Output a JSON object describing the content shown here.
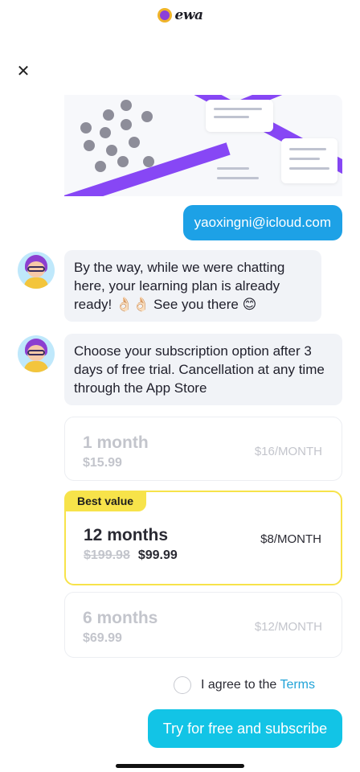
{
  "app": {
    "logo_text": "ewa"
  },
  "chat": {
    "user_email": "yaoxingni@icloud.com",
    "bot_message_1": "By the way, while we were chatting here, your learning plan is already ready! 👌🏻👌🏻 See you there 😊",
    "bot_message_2": "Choose your subscription option after 3 days of free trial. Cancellation at any time through the App Store"
  },
  "plans": [
    {
      "name": "1 month",
      "price": "$15.99",
      "per_month": "$16/MONTH"
    },
    {
      "badge": "Best value",
      "name": "12 months",
      "old_price": "$199.98",
      "price": "$99.99",
      "per_month": "$8/MONTH"
    },
    {
      "name": "6 months",
      "price": "$69.99",
      "per_month": "$12/MONTH"
    }
  ],
  "agreement": {
    "prefix": "I agree to the",
    "link": "Terms"
  },
  "cta": {
    "label": "Try for free and subscribe"
  },
  "colors": {
    "accent": "#12c4e6",
    "user_bubble": "#1da1e6",
    "highlight": "#f7e34a",
    "purple": "#8747f5"
  }
}
